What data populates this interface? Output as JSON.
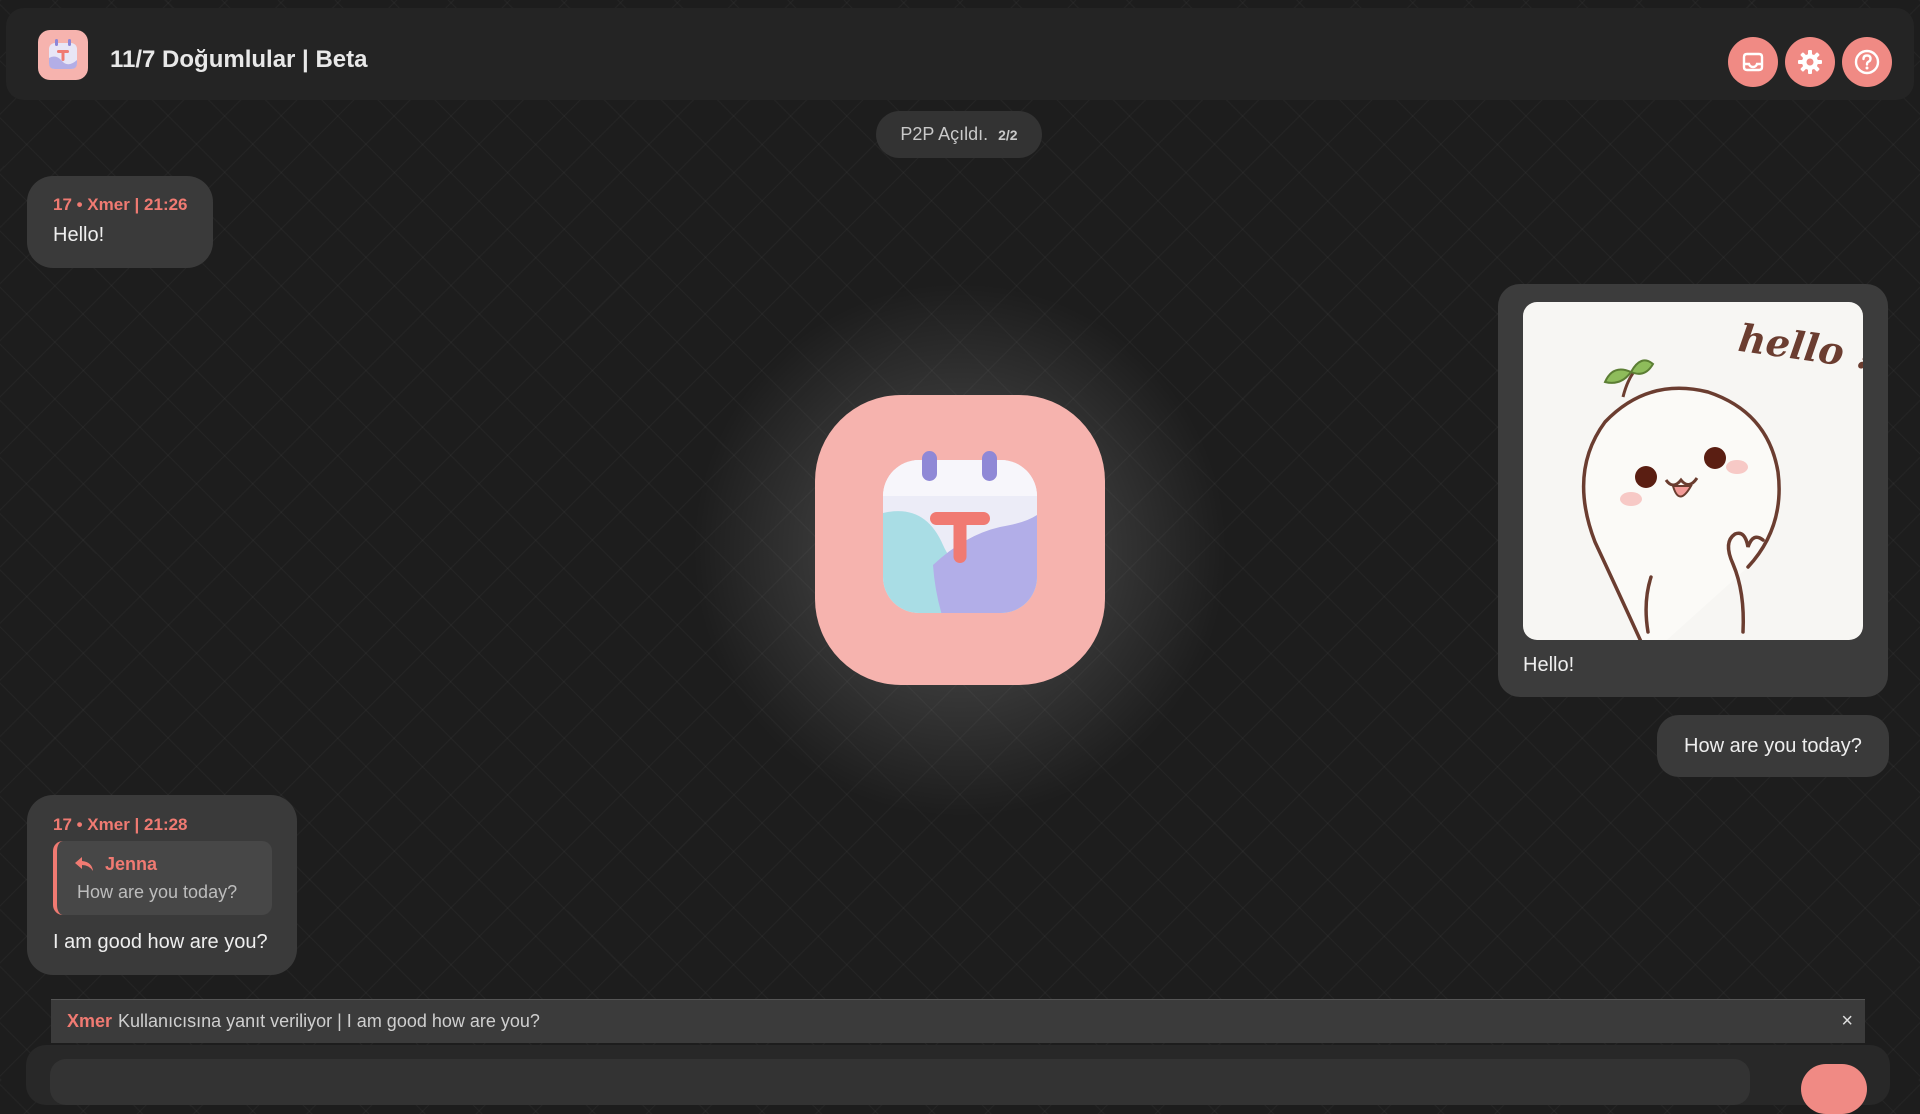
{
  "header": {
    "title": "11/7 Doğumlular | Beta",
    "buttons": [
      "inbox-icon",
      "gear-icon",
      "help-icon"
    ]
  },
  "status": {
    "label": "P2P Açıldı.",
    "count": "2/2"
  },
  "messages": [
    {
      "meta": "17 • Xmer | 21:26",
      "text": "Hello!"
    },
    {
      "sticker_text": "hello !",
      "caption": "Hello!"
    },
    {
      "text": "How are you today?"
    },
    {
      "meta": "17 • Xmer | 21:28",
      "quote": {
        "name": "Jenna",
        "text": "How are you today?"
      },
      "text": "I am good how are you?"
    }
  ],
  "reply": {
    "name": "Xmer",
    "text": "Kullanıcısına yanıt veriliyor | I am good how are you?",
    "close": "×"
  },
  "colors": {
    "accent": "#f08a84",
    "logo_bg": "#f6b3ae",
    "bubble": "#3a3a3a"
  }
}
